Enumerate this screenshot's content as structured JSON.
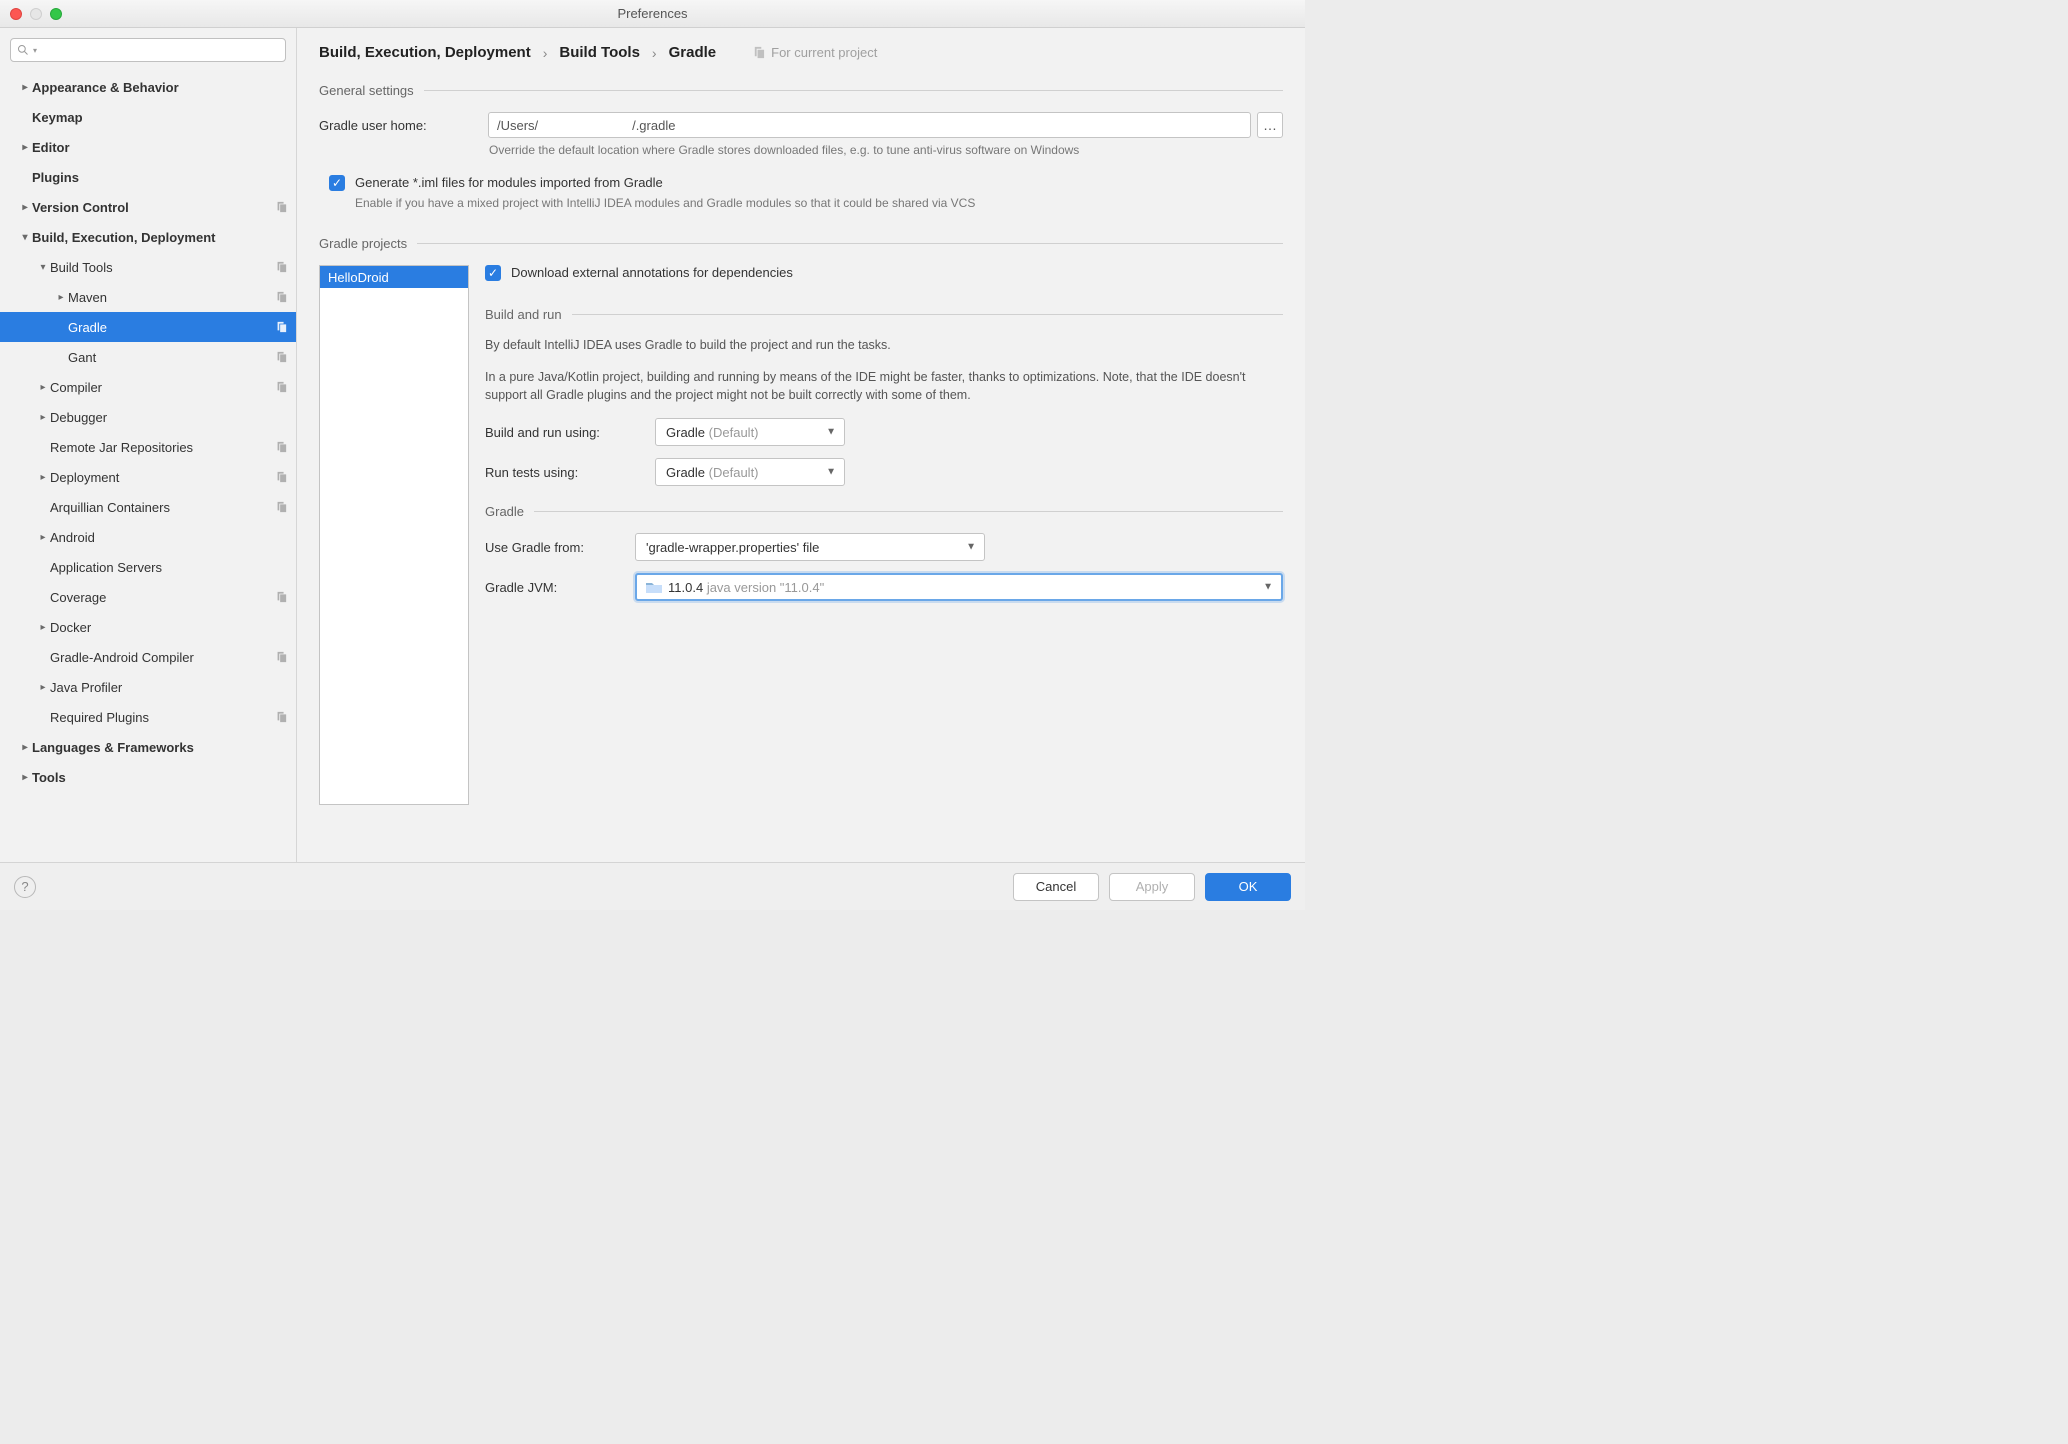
{
  "window": {
    "title": "Preferences"
  },
  "search": {
    "placeholder": ""
  },
  "sidebar": {
    "items": [
      {
        "label": "Appearance & Behavior",
        "indent": 0,
        "arrow": "right",
        "bold": true,
        "badge": false,
        "selected": false
      },
      {
        "label": "Keymap",
        "indent": 0,
        "arrow": "",
        "bold": true,
        "badge": false,
        "selected": false
      },
      {
        "label": "Editor",
        "indent": 0,
        "arrow": "right",
        "bold": true,
        "badge": false,
        "selected": false
      },
      {
        "label": "Plugins",
        "indent": 0,
        "arrow": "",
        "bold": true,
        "badge": false,
        "selected": false
      },
      {
        "label": "Version Control",
        "indent": 0,
        "arrow": "right",
        "bold": true,
        "badge": true,
        "selected": false
      },
      {
        "label": "Build, Execution, Deployment",
        "indent": 0,
        "arrow": "down",
        "bold": true,
        "badge": false,
        "selected": false
      },
      {
        "label": "Build Tools",
        "indent": 1,
        "arrow": "down",
        "bold": false,
        "badge": true,
        "selected": false
      },
      {
        "label": "Maven",
        "indent": 2,
        "arrow": "right",
        "bold": false,
        "badge": true,
        "selected": false
      },
      {
        "label": "Gradle",
        "indent": 2,
        "arrow": "",
        "bold": false,
        "badge": true,
        "selected": true
      },
      {
        "label": "Gant",
        "indent": 2,
        "arrow": "",
        "bold": false,
        "badge": true,
        "selected": false
      },
      {
        "label": "Compiler",
        "indent": 1,
        "arrow": "right",
        "bold": false,
        "badge": true,
        "selected": false
      },
      {
        "label": "Debugger",
        "indent": 1,
        "arrow": "right",
        "bold": false,
        "badge": false,
        "selected": false
      },
      {
        "label": "Remote Jar Repositories",
        "indent": 1,
        "arrow": "",
        "bold": false,
        "badge": true,
        "selected": false
      },
      {
        "label": "Deployment",
        "indent": 1,
        "arrow": "right",
        "bold": false,
        "badge": true,
        "selected": false
      },
      {
        "label": "Arquillian Containers",
        "indent": 1,
        "arrow": "",
        "bold": false,
        "badge": true,
        "selected": false
      },
      {
        "label": "Android",
        "indent": 1,
        "arrow": "right",
        "bold": false,
        "badge": false,
        "selected": false
      },
      {
        "label": "Application Servers",
        "indent": 1,
        "arrow": "",
        "bold": false,
        "badge": false,
        "selected": false
      },
      {
        "label": "Coverage",
        "indent": 1,
        "arrow": "",
        "bold": false,
        "badge": true,
        "selected": false
      },
      {
        "label": "Docker",
        "indent": 1,
        "arrow": "right",
        "bold": false,
        "badge": false,
        "selected": false
      },
      {
        "label": "Gradle-Android Compiler",
        "indent": 1,
        "arrow": "",
        "bold": false,
        "badge": true,
        "selected": false
      },
      {
        "label": "Java Profiler",
        "indent": 1,
        "arrow": "right",
        "bold": false,
        "badge": false,
        "selected": false
      },
      {
        "label": "Required Plugins",
        "indent": 1,
        "arrow": "",
        "bold": false,
        "badge": true,
        "selected": false
      },
      {
        "label": "Languages & Frameworks",
        "indent": 0,
        "arrow": "right",
        "bold": true,
        "badge": false,
        "selected": false
      },
      {
        "label": "Tools",
        "indent": 0,
        "arrow": "right",
        "bold": true,
        "badge": false,
        "selected": false
      }
    ]
  },
  "breadcrumb": {
    "parts": [
      "Build, Execution, Deployment",
      "Build Tools",
      "Gradle"
    ],
    "for_project": "For current project"
  },
  "general": {
    "header": "General settings",
    "user_home_label": "Gradle user home:",
    "user_home_value": "/Users/                          /.gradle",
    "user_home_hint": "Override the default location where Gradle stores downloaded files, e.g. to tune anti-virus software on Windows",
    "generate_iml_label": "Generate *.iml files for modules imported from Gradle",
    "generate_iml_hint": "Enable if you have a mixed project with IntelliJ IDEA modules and Gradle modules so that it could be shared via VCS"
  },
  "projects": {
    "header": "Gradle projects",
    "list": [
      "HelloDroid"
    ],
    "download_annotations_label": "Download external annotations for dependencies",
    "build_run": {
      "header": "Build and run",
      "desc1": "By default IntelliJ IDEA uses Gradle to build the project and run the tasks.",
      "desc2": "In a pure Java/Kotlin project, building and running by means of the IDE might be faster, thanks to optimizations. Note, that the IDE doesn't support all Gradle plugins and the project might not be built correctly with some of them.",
      "build_using_label": "Build and run using:",
      "build_using_value": "Gradle",
      "build_using_suffix": "(Default)",
      "run_tests_label": "Run tests using:",
      "run_tests_value": "Gradle",
      "run_tests_suffix": "(Default)"
    },
    "gradle_section": {
      "header": "Gradle",
      "use_from_label": "Use Gradle from:",
      "use_from_value": "'gradle-wrapper.properties' file",
      "jvm_label": "Gradle JVM:",
      "jvm_value": "11.0.4",
      "jvm_suffix": "java version \"11.0.4\""
    }
  },
  "footer": {
    "cancel": "Cancel",
    "apply": "Apply",
    "ok": "OK"
  }
}
